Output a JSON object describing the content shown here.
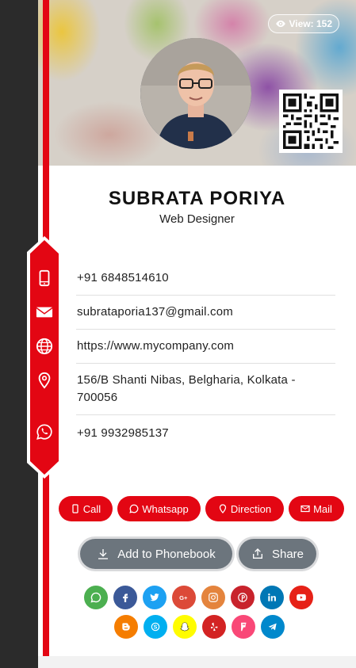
{
  "header": {
    "view_label": "View: 152"
  },
  "profile": {
    "name": "SUBRATA PORIYA",
    "title": "Web Designer"
  },
  "contact": {
    "phone": "+91 6848514610",
    "email": "subrataporia137@gmail.com",
    "website": "https://www.mycompany.com",
    "address": "156/B Shanti Nibas, Belgharia, Kolkata - 700056",
    "whatsapp": "+91 9932985137"
  },
  "actions": {
    "call": "Call",
    "whatsapp": "Whatsapp",
    "direction": "Direction",
    "mail": "Mail"
  },
  "buttons": {
    "add_phonebook": "Add to Phonebook",
    "share": "Share"
  },
  "colors": {
    "accent": "#e30613",
    "button_gray": "#6c757d"
  },
  "social_icons": [
    {
      "name": "whatsapp-icon",
      "color": "#4caf50"
    },
    {
      "name": "facebook-icon",
      "color": "#3b5998"
    },
    {
      "name": "twitter-icon",
      "color": "#1da1f2"
    },
    {
      "name": "google-plus-icon",
      "color": "#dc4a38"
    },
    {
      "name": "instagram-icon",
      "color": "#e4843d"
    },
    {
      "name": "pinterest-icon",
      "color": "#c8232c"
    },
    {
      "name": "linkedin-icon",
      "color": "#0077b5"
    },
    {
      "name": "youtube-icon",
      "color": "#e62117"
    },
    {
      "name": "blogger-icon",
      "color": "#f57d00"
    },
    {
      "name": "skype-icon",
      "color": "#00aff0"
    },
    {
      "name": "snapchat-icon",
      "color": "#fffc00"
    },
    {
      "name": "yelp-icon",
      "color": "#d32323"
    },
    {
      "name": "foursquare-icon",
      "color": "#f94877"
    },
    {
      "name": "telegram-icon",
      "color": "#0088cc"
    }
  ]
}
